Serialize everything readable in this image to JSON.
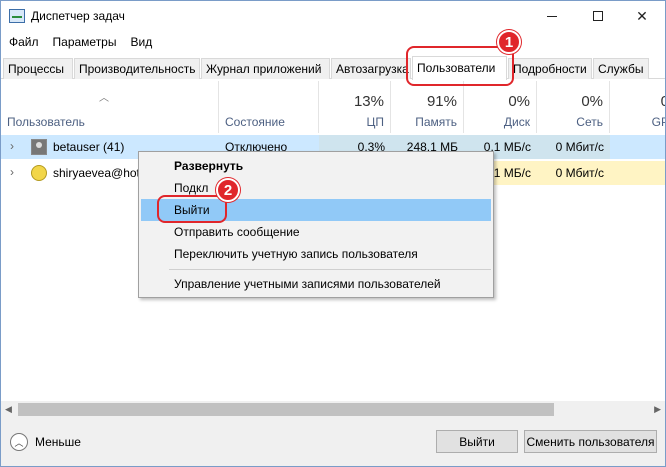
{
  "window": {
    "title": "Диспетчер задач"
  },
  "menu": [
    "Файл",
    "Параметры",
    "Вид"
  ],
  "tabs": [
    "Процессы",
    "Производительность",
    "Журнал приложений",
    "Автозагрузка",
    "Пользователи",
    "Подробности",
    "Службы"
  ],
  "active_tab": "Пользователи",
  "annotations": {
    "badge1": "1",
    "badge2": "2"
  },
  "columns": {
    "user": {
      "label": "Пользователь"
    },
    "status": {
      "label": "Состояние"
    },
    "cpu": {
      "pct": "13%",
      "label": "ЦП"
    },
    "mem": {
      "pct": "91%",
      "label": "Память"
    },
    "disk": {
      "pct": "0%",
      "label": "Диск"
    },
    "net": {
      "pct": "0%",
      "label": "Сеть"
    },
    "gpu": {
      "pct": "0",
      "label": "GP"
    }
  },
  "rows": [
    {
      "user": "betauser (41)",
      "status": "Отключено",
      "cpu": "0.3%",
      "mem": "248.1 МБ",
      "disk": "0.1 МБ/с",
      "net": "0 Мбит/с"
    },
    {
      "user": "shiryaevea@hot",
      "status": "",
      "cpu": "",
      "mem": "",
      "disk": "0.1 МБ/с",
      "net": "0 Мбит/с"
    }
  ],
  "context_menu": {
    "expand": "Развернуть",
    "connect": "Подкл",
    "signout": "Выйти",
    "send_message": "Отправить сообщение",
    "switch_account": "Переключить учетную запись пользователя",
    "manage_accounts": "Управление учетными записями пользователей"
  },
  "footer": {
    "fewer": "Меньше",
    "signout_btn": "Выйти",
    "switch_btn": "Сменить пользователя"
  },
  "colors": {
    "heat_light": "#fff4c4",
    "heat_selected": "#cfe4ee",
    "selection": "#cce8ff",
    "menu_hover": "#91c9f7",
    "annotation": "#e0262b"
  }
}
